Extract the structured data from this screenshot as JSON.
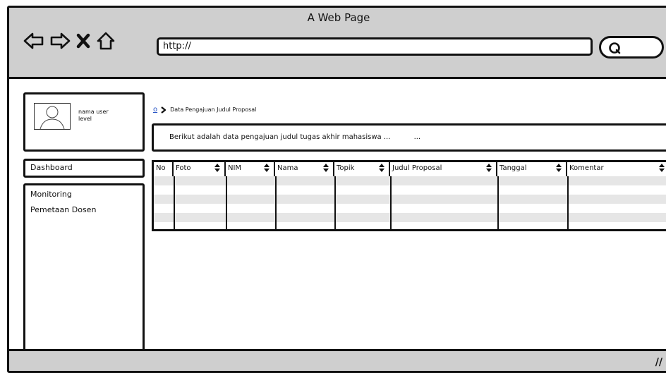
{
  "window": {
    "title": "A Web Page"
  },
  "browser": {
    "url": "http://"
  },
  "sidebar": {
    "user_name": "nama user",
    "user_level": "level",
    "dashboard_label": "Dashboard",
    "menu_items": [
      "Monitoring",
      "Pemetaan Dosen"
    ]
  },
  "breadcrumb": {
    "home_icon": "home-icon",
    "separator_icon": "chevron-right-icon",
    "current": "Data Pengajuan Judul Proposal"
  },
  "info": {
    "text": "Berikut adalah data pengajuan judul tugas akhir mahasiswa ...",
    "ellipsis": "..."
  },
  "table": {
    "columns": [
      "No",
      "Foto",
      "NIM",
      "Nama",
      "Topik",
      "Judul Proposal",
      "Tanggal",
      "Komentar"
    ],
    "rows": 4
  }
}
